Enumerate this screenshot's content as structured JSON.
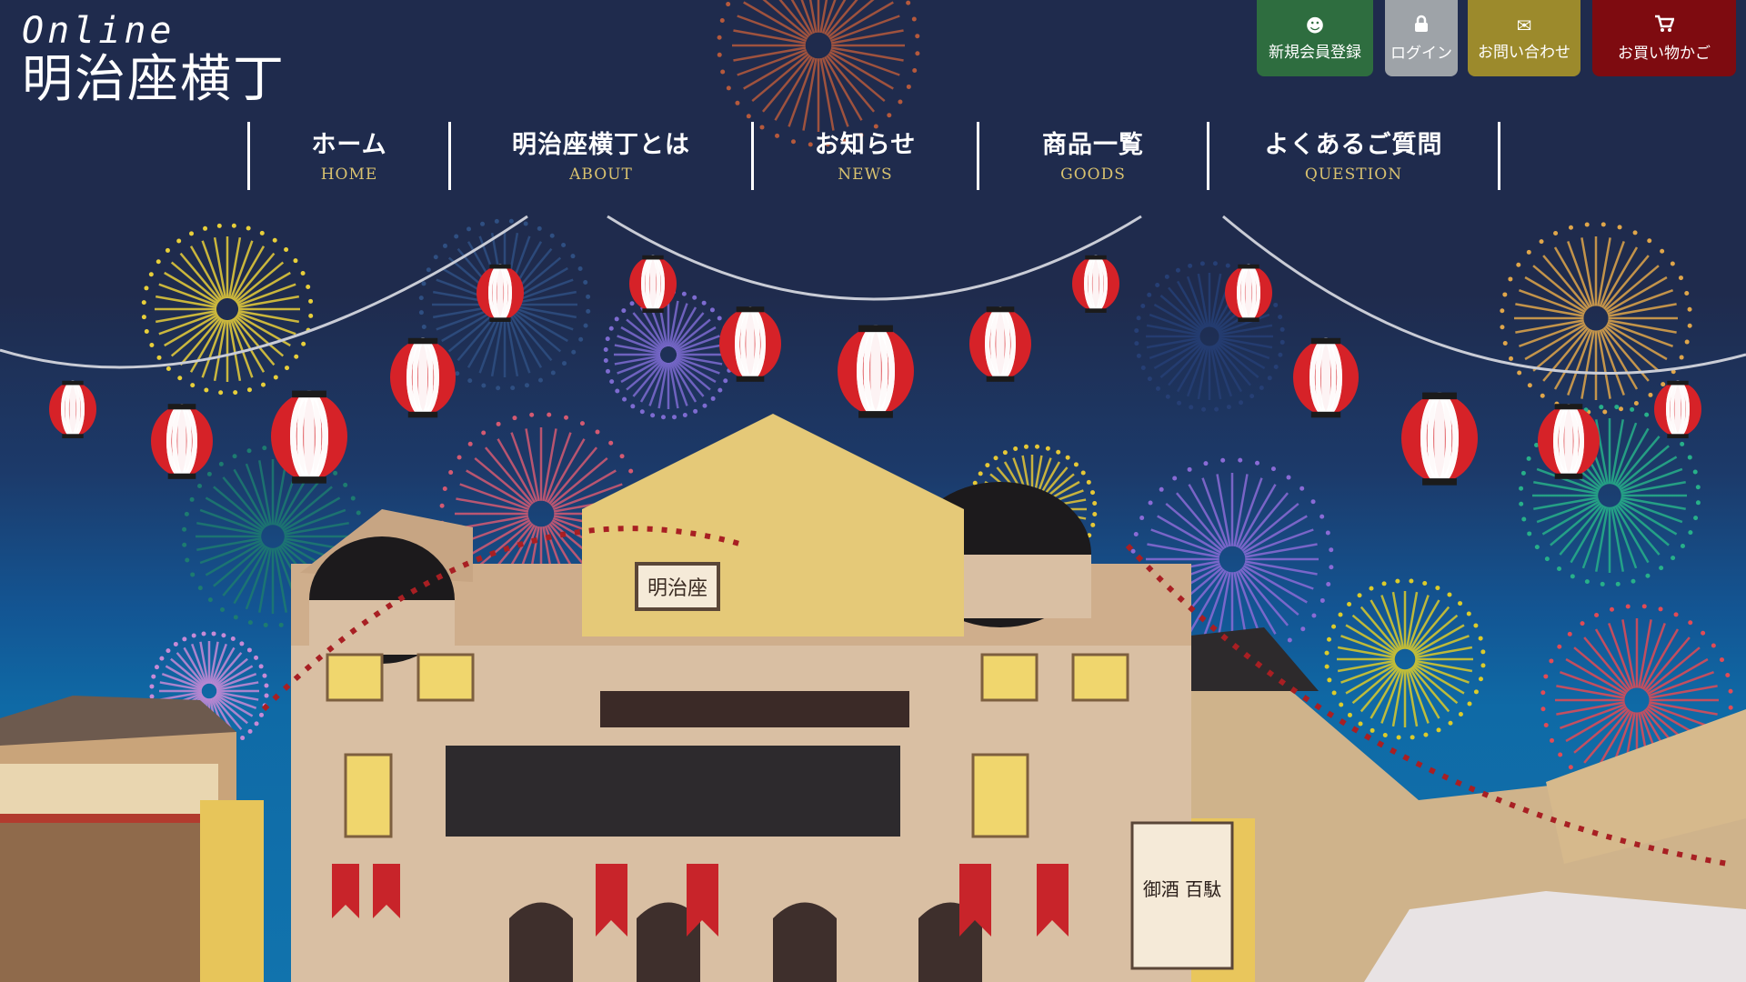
{
  "site": {
    "logo_line1": "Online",
    "logo_line2": "明治座横丁"
  },
  "top_actions": [
    {
      "label": "新規会員登録",
      "icon": "user-icon",
      "color": "#2e6d3f"
    },
    {
      "label": "ログイン",
      "icon": "lock-icon",
      "color": "#9ea3a8"
    },
    {
      "label": "お問い合わせ",
      "icon": "mail-icon",
      "color": "#9c8a2c"
    },
    {
      "label": "お買い物かご",
      "icon": "cart-icon",
      "color": "#7e0b10"
    }
  ],
  "nav": [
    {
      "jp": "ホーム",
      "en": "HOME"
    },
    {
      "jp": "明治座横丁とは",
      "en": "ABOUT"
    },
    {
      "jp": "お知らせ",
      "en": "NEWS"
    },
    {
      "jp": "商品一覧",
      "en": "GOODS"
    },
    {
      "jp": "よくあるご質問",
      "en": "QUESTION"
    }
  ],
  "hero": {
    "theatre_sign": "明治座",
    "banner_text": "御酒 百駄"
  },
  "colors": {
    "background": "#1f2b4d",
    "nav_en_text": "#d9c26f",
    "lantern_red": "#d62228"
  }
}
